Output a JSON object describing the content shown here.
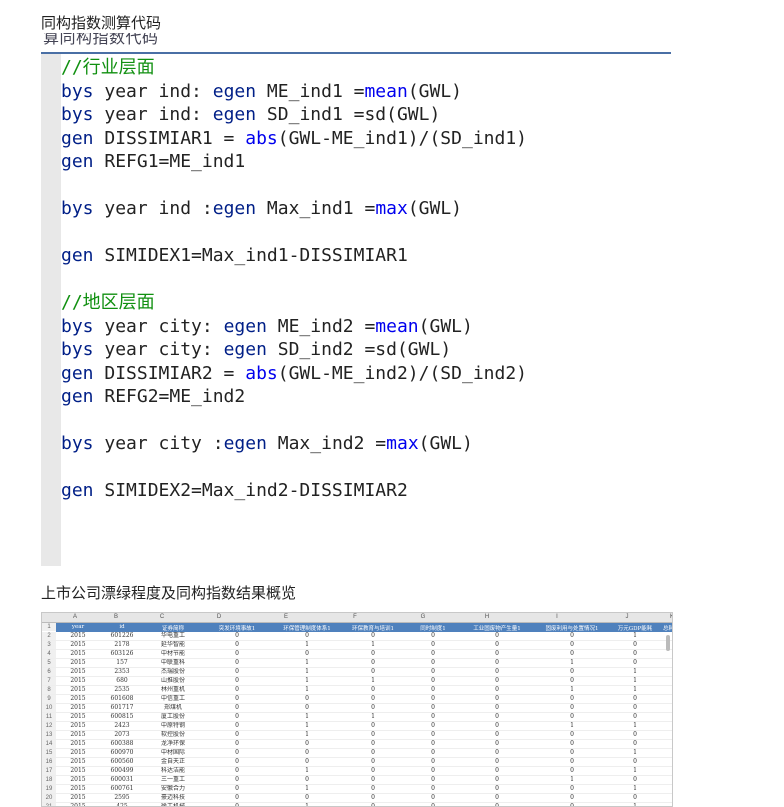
{
  "headings": {
    "code_title": "同构指数测算代码",
    "results_title": "上市公司漂绿程度及同构指数结果概览"
  },
  "clipped_header": "算同构指数代码",
  "code_lines": [
    [
      {
        "t": "//行业层面",
        "c": "cm"
      }
    ],
    [
      {
        "t": "bys",
        "c": "kw"
      },
      {
        "t": " year ind: ",
        "c": ""
      },
      {
        "t": "egen",
        "c": "kw"
      },
      {
        "t": " ME_ind1 =",
        "c": ""
      },
      {
        "t": "mean",
        "c": "fn"
      },
      {
        "t": "(GWL)",
        "c": ""
      }
    ],
    [
      {
        "t": "bys",
        "c": "kw"
      },
      {
        "t": " year ind: ",
        "c": ""
      },
      {
        "t": "egen",
        "c": "kw"
      },
      {
        "t": " SD_ind1 =sd(GWL)",
        "c": ""
      }
    ],
    [
      {
        "t": "gen",
        "c": "kw"
      },
      {
        "t": " DISSIMIAR1 = ",
        "c": ""
      },
      {
        "t": "abs",
        "c": "fn"
      },
      {
        "t": "(GWL-ME_ind1)/(SD_ind1)",
        "c": ""
      }
    ],
    [
      {
        "t": "gen",
        "c": "kw"
      },
      {
        "t": " REFG1=ME_ind1",
        "c": ""
      }
    ],
    [],
    [
      {
        "t": "bys",
        "c": "kw"
      },
      {
        "t": " year ind :",
        "c": ""
      },
      {
        "t": "egen",
        "c": "kw"
      },
      {
        "t": " Max_ind1 =",
        "c": ""
      },
      {
        "t": "max",
        "c": "fn"
      },
      {
        "t": "(GWL)",
        "c": ""
      }
    ],
    [],
    [
      {
        "t": "gen",
        "c": "kw"
      },
      {
        "t": " SIMIDEX1=Max_ind1-DISSIMIAR1",
        "c": ""
      }
    ],
    [],
    [
      {
        "t": "//地区层面",
        "c": "cm"
      }
    ],
    [
      {
        "t": "bys",
        "c": "kw"
      },
      {
        "t": " year city: ",
        "c": ""
      },
      {
        "t": "egen",
        "c": "kw"
      },
      {
        "t": " ME_ind2 =",
        "c": ""
      },
      {
        "t": "mean",
        "c": "fn"
      },
      {
        "t": "(GWL)",
        "c": ""
      }
    ],
    [
      {
        "t": "bys",
        "c": "kw"
      },
      {
        "t": " year city: ",
        "c": ""
      },
      {
        "t": "egen",
        "c": "kw"
      },
      {
        "t": " SD_ind2 =sd(GWL)",
        "c": ""
      }
    ],
    [
      {
        "t": "gen",
        "c": "kw"
      },
      {
        "t": " DISSIMIAR2 = ",
        "c": ""
      },
      {
        "t": "abs",
        "c": "fn"
      },
      {
        "t": "(GWL-ME_ind2)/(SD_ind2)",
        "c": ""
      }
    ],
    [
      {
        "t": "gen",
        "c": "kw"
      },
      {
        "t": " REFG2=ME_ind2",
        "c": ""
      }
    ],
    [],
    [
      {
        "t": "bys",
        "c": "kw"
      },
      {
        "t": " year city :",
        "c": ""
      },
      {
        "t": "egen",
        "c": "kw"
      },
      {
        "t": " Max_ind2 =",
        "c": ""
      },
      {
        "t": "max",
        "c": "fn"
      },
      {
        "t": "(GWL)",
        "c": ""
      }
    ],
    [],
    [
      {
        "t": "gen",
        "c": "kw"
      },
      {
        "t": " SIMIDEX2=Max_ind2-DISSIMIAR2",
        "c": ""
      }
    ]
  ],
  "spreadsheet": {
    "col_letters": [
      "A",
      "B",
      "C",
      "D",
      "E",
      "F",
      "G",
      "H",
      "I",
      "J",
      "K"
    ],
    "headers": [
      "year",
      "id",
      "证券简称",
      "突发环境事故1",
      "环保管理制度体系1",
      "环保教育与培训1",
      "同时制度1",
      "工业固废物产生量1",
      "固废利用与处置情况1",
      "万元GDP能耗",
      "总耗水1"
    ],
    "rows": [
      [
        "2015",
        "601226",
        "华电重工",
        "0",
        "0",
        "0",
        "0",
        "0",
        "0",
        "1"
      ],
      [
        "2015",
        "2178",
        "延华智能",
        "0",
        "1",
        "1",
        "0",
        "0",
        "0",
        "0"
      ],
      [
        "2015",
        "603126",
        "中材节能",
        "0",
        "0",
        "0",
        "0",
        "0",
        "0",
        "0"
      ],
      [
        "2015",
        "157",
        "中联重科",
        "0",
        "1",
        "0",
        "0",
        "0",
        "1",
        "0"
      ],
      [
        "2015",
        "2353",
        "杰瑞股份",
        "0",
        "1",
        "0",
        "0",
        "0",
        "0",
        "1"
      ],
      [
        "2015",
        "680",
        "山推股份",
        "0",
        "1",
        "1",
        "0",
        "0",
        "0",
        "1"
      ],
      [
        "2015",
        "2535",
        "林州重机",
        "0",
        "1",
        "0",
        "0",
        "0",
        "1",
        "1"
      ],
      [
        "2015",
        "601608",
        "中信重工",
        "0",
        "0",
        "0",
        "0",
        "0",
        "0",
        "0"
      ],
      [
        "2015",
        "601717",
        "郑煤机",
        "0",
        "0",
        "0",
        "0",
        "0",
        "0",
        "0"
      ],
      [
        "2015",
        "600815",
        "厦工股份",
        "0",
        "1",
        "1",
        "0",
        "0",
        "0",
        "0"
      ],
      [
        "2015",
        "2423",
        "中原特钢",
        "0",
        "1",
        "0",
        "0",
        "0",
        "1",
        "1"
      ],
      [
        "2015",
        "2073",
        "软控股份",
        "0",
        "1",
        "0",
        "0",
        "0",
        "0",
        "0"
      ],
      [
        "2015",
        "600388",
        "龙净环保",
        "0",
        "0",
        "0",
        "0",
        "0",
        "0",
        "0"
      ],
      [
        "2015",
        "600970",
        "中材国际",
        "0",
        "0",
        "0",
        "0",
        "0",
        "0",
        "1"
      ],
      [
        "2015",
        "600560",
        "金自天正",
        "0",
        "0",
        "0",
        "0",
        "0",
        "0",
        "0"
      ],
      [
        "2015",
        "600499",
        "科达洁能",
        "0",
        "1",
        "0",
        "0",
        "0",
        "0",
        "1"
      ],
      [
        "2015",
        "600031",
        "三一重工",
        "0",
        "0",
        "0",
        "0",
        "0",
        "1",
        "0"
      ],
      [
        "2015",
        "600761",
        "安徽合力",
        "0",
        "1",
        "0",
        "0",
        "0",
        "0",
        "1"
      ],
      [
        "2015",
        "2595",
        "豪迈科技",
        "0",
        "0",
        "0",
        "0",
        "0",
        "0",
        "0"
      ],
      [
        "2015",
        "425",
        "徐工机械",
        "0",
        "1",
        "0",
        "0",
        "0",
        "0",
        "1"
      ]
    ]
  }
}
